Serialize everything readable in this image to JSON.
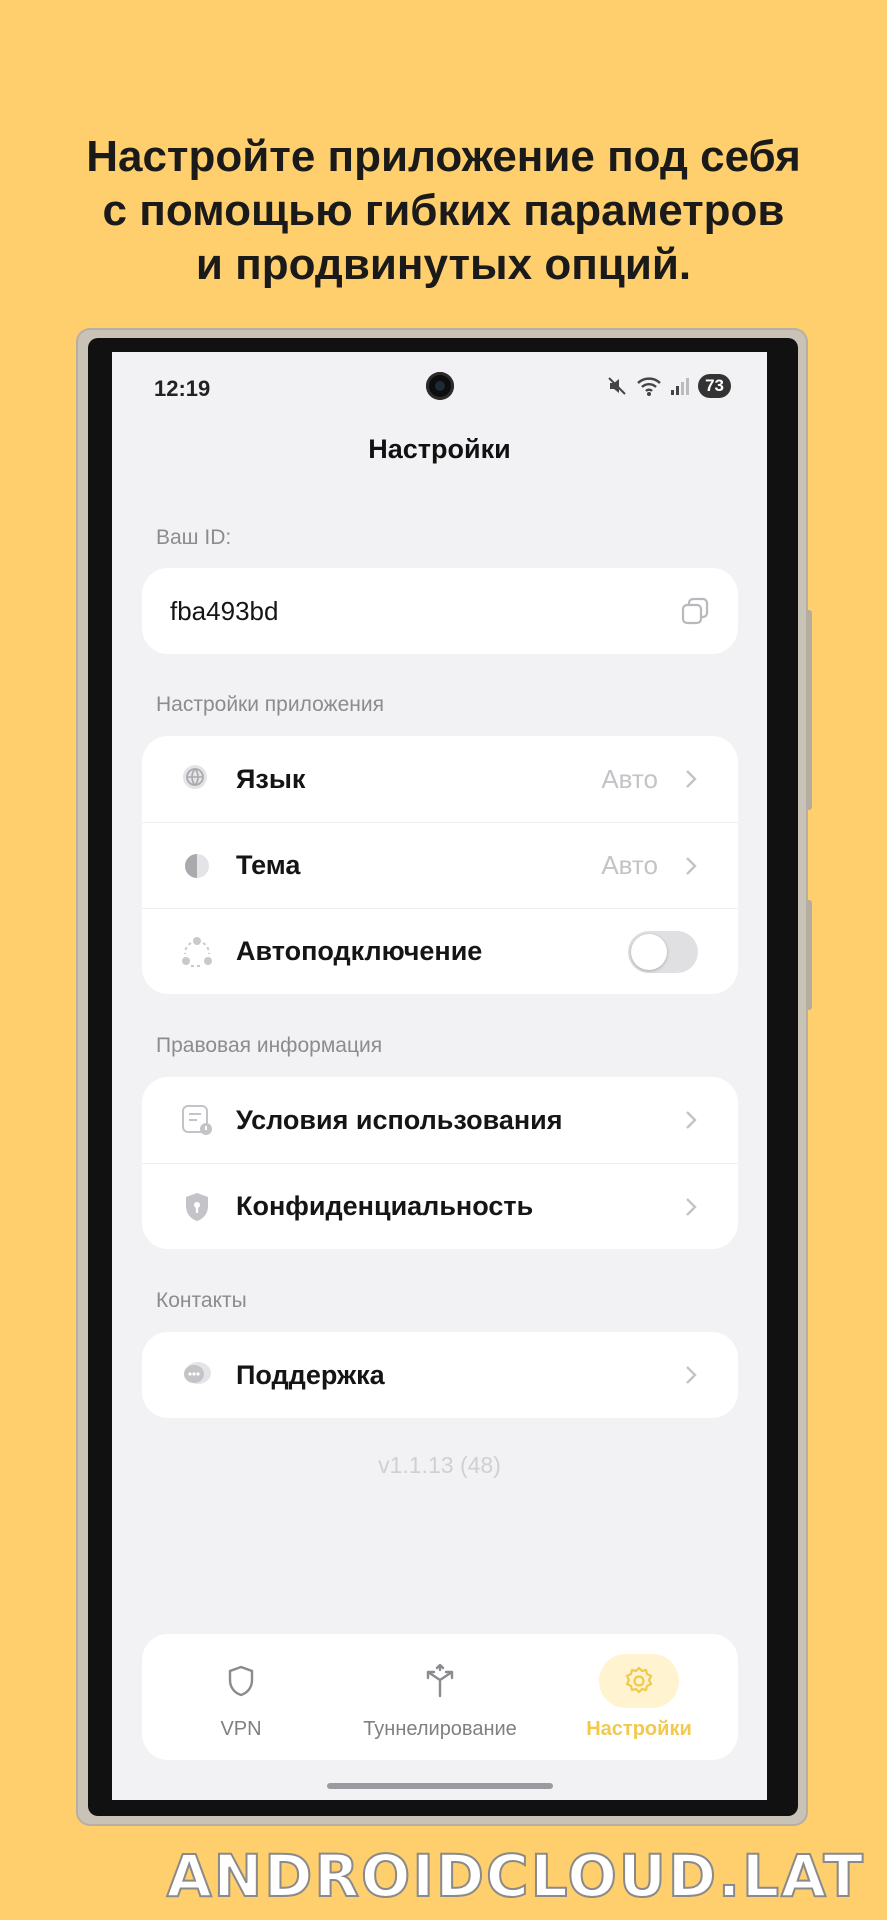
{
  "headline": {
    "line1": "Настройте приложение под себя",
    "line2": "с помощью гибких параметров",
    "line3": "и продвинутых опций."
  },
  "status_bar": {
    "time": "12:19",
    "battery": "73"
  },
  "header": {
    "title": "Настройки"
  },
  "id_section": {
    "label": "Ваш ID:",
    "value": "fba493bd"
  },
  "app_settings": {
    "label": "Настройки приложения",
    "language": {
      "label": "Язык",
      "value": "Авто"
    },
    "theme": {
      "label": "Тема",
      "value": "Авто"
    },
    "autoconnect": {
      "label": "Автоподключение",
      "enabled": false
    }
  },
  "legal": {
    "label": "Правовая информация",
    "terms": "Условия использования",
    "privacy": "Конфиденциальность"
  },
  "contacts": {
    "label": "Контакты",
    "support": "Поддержка"
  },
  "version": "v1.1.13 (48)",
  "tabs": [
    {
      "label": "VPN",
      "icon": "shield-icon",
      "active": false
    },
    {
      "label": "Туннелирование",
      "icon": "split-arrows-icon",
      "active": false
    },
    {
      "label": "Настройки",
      "icon": "gear-icon",
      "active": true
    }
  ],
  "colors": {
    "background": "#FFCF6E",
    "accent": "#F2C94C",
    "screen": "#F2F2F4"
  },
  "watermark": "ANDROIDCLOUD.LAT"
}
